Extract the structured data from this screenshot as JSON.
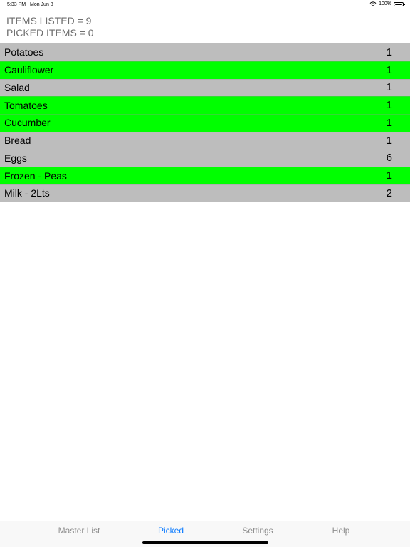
{
  "status_bar": {
    "time": "5:33 PM",
    "date": "Mon Jun 8",
    "battery": "100%",
    "wifi_icon": "wifi-icon",
    "battery_icon": "battery-icon"
  },
  "summary": {
    "items_listed": "ITEMS LISTED = 9",
    "picked_items": "PICKED ITEMS = 0"
  },
  "colors": {
    "row_default": "#bdbdbd",
    "row_highlight": "#00ff00",
    "tab_active": "#0a7aff",
    "tab_inactive": "#8e8e8e"
  },
  "items": [
    {
      "name": "Potatoes",
      "qty": "1",
      "highlight": false
    },
    {
      "name": "Cauliflower",
      "qty": "1",
      "highlight": true
    },
    {
      "name": "Salad",
      "qty": "1",
      "highlight": false
    },
    {
      "name": "Tomatoes",
      "qty": "1",
      "highlight": true
    },
    {
      "name": "Cucumber",
      "qty": "1",
      "highlight": true
    },
    {
      "name": "Bread",
      "qty": "1",
      "highlight": false
    },
    {
      "name": "Eggs",
      "qty": "6",
      "highlight": false
    },
    {
      "name": "Frozen - Peas",
      "qty": "1",
      "highlight": true
    },
    {
      "name": "Milk - 2Lts",
      "qty": "2",
      "highlight": false
    }
  ],
  "tabs": [
    {
      "label": "Master List",
      "active": false
    },
    {
      "label": "Picked",
      "active": true
    },
    {
      "label": "Settings",
      "active": false
    },
    {
      "label": "Help",
      "active": false
    }
  ]
}
